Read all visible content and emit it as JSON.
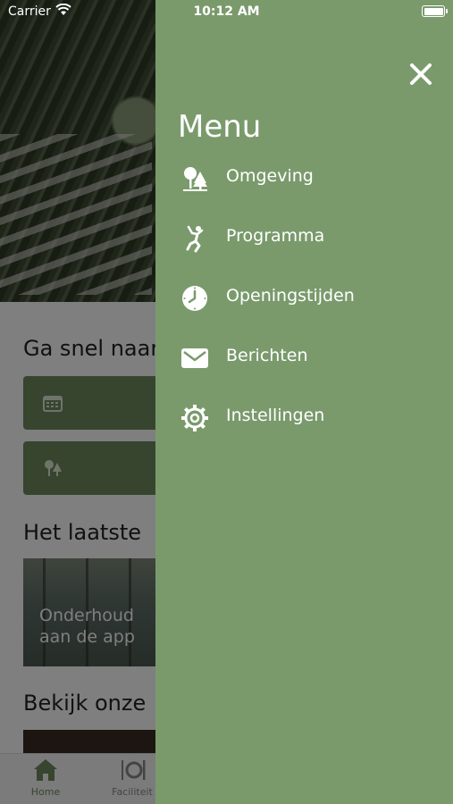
{
  "status_bar": {
    "carrier": "Carrier",
    "time": "10:12 AM",
    "battery_level": 1.0
  },
  "background": {
    "quick_section_title": "Ga snel naar",
    "latest_section_title": "Het laatste",
    "news_title_line1": "Onderhoud",
    "news_title_line2": "aan de app",
    "explore_section_title": "Bekijk onze",
    "tabs": [
      {
        "label": "Home",
        "icon": "home-icon"
      },
      {
        "label": "Faciliteit",
        "icon": "utensils-icon"
      }
    ]
  },
  "drawer": {
    "title": "Menu",
    "close_icon": "close-icon",
    "items": [
      {
        "label": "Omgeving",
        "icon": "trees-icon"
      },
      {
        "label": "Programma",
        "icon": "person-jumping-icon"
      },
      {
        "label": "Openingstijden",
        "icon": "clock-icon"
      },
      {
        "label": "Berichten",
        "icon": "envelope-icon"
      },
      {
        "label": "Instellingen",
        "icon": "gear-icon"
      }
    ]
  },
  "colors": {
    "drawer_bg": "#7a9a6c",
    "accent_green": "#6e8a5c",
    "text_on_green": "#ffffff"
  }
}
